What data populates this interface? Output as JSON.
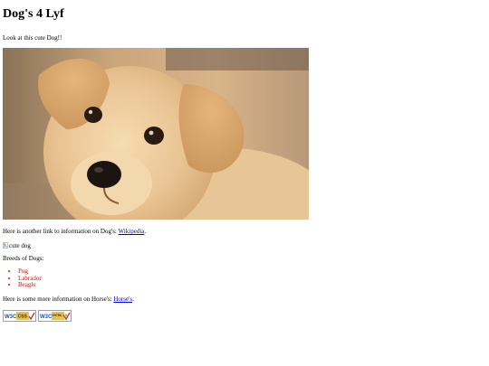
{
  "page": {
    "title": "Dog's 4 Lyf",
    "intro": "Look at this cute Dog!!",
    "photo_subject": "golden retriever puppy",
    "link_para": {
      "before": "Here is another link to information on Dog's: ",
      "link": "Wikipedia",
      "after": "."
    },
    "broken_image_alt": "cute dog",
    "breeds_title": "Breeds of Dogs:",
    "breeds": [
      "Pug",
      "Labrador",
      "Beagle"
    ],
    "horse_para": {
      "before": "Here is some more information on Horse's: ",
      "link": "Horse's",
      "after": "."
    },
    "badges": [
      {
        "logo": "W3C",
        "label": "CSS"
      },
      {
        "logo": "W3C",
        "label": "XHTML 1.0"
      }
    ],
    "colors": {
      "list": "#ff0000",
      "link": "#0000ee",
      "badge_blue": "#1a56a6",
      "badge_gold": "#f0c040"
    }
  }
}
